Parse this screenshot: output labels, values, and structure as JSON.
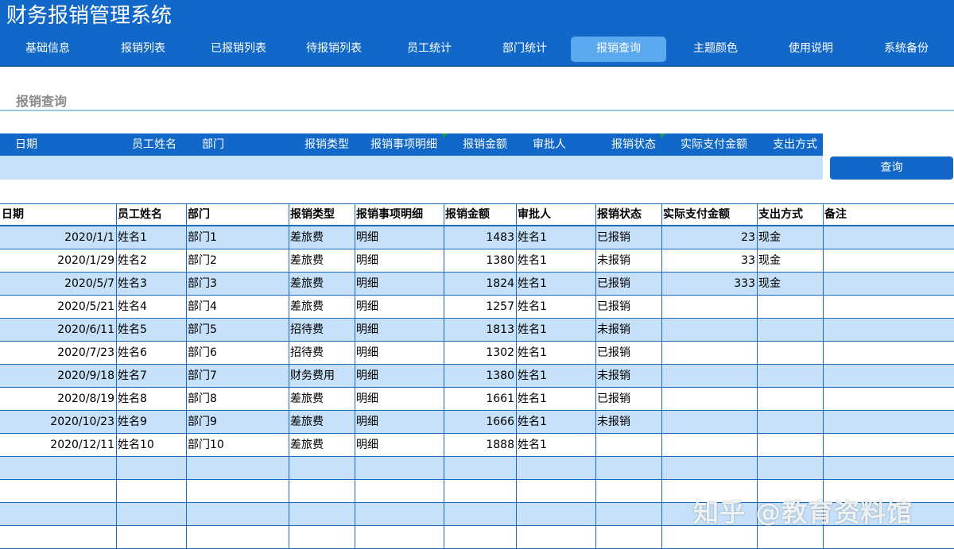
{
  "app_title": "财务报销管理系统",
  "nav": [
    {
      "label": "基础信息",
      "name": "nav-basic-info"
    },
    {
      "label": "报销列表",
      "name": "nav-reimburse-list"
    },
    {
      "label": "已报销列表",
      "name": "nav-reimbursed-list"
    },
    {
      "label": "待报销列表",
      "name": "nav-pending-list"
    },
    {
      "label": "员工统计",
      "name": "nav-employee-stats"
    },
    {
      "label": "部门统计",
      "name": "nav-department-stats"
    },
    {
      "label": "报销查询",
      "name": "nav-reimburse-query",
      "active": true
    },
    {
      "label": "主题颜色",
      "name": "nav-theme-color"
    },
    {
      "label": "使用说明",
      "name": "nav-instructions"
    },
    {
      "label": "系统备份",
      "name": "nav-system-backup"
    }
  ],
  "section_title": "报销查询",
  "filter": {
    "headers": [
      "日期",
      "员工姓名",
      "部门",
      "报销类型",
      "报销事项明细",
      "报销金额",
      "审批人",
      "报销状态",
      "实际支付金额",
      "支出方式"
    ],
    "query_button": "查询"
  },
  "table": {
    "columns": [
      "日期",
      "员工姓名",
      "部门",
      "报销类型",
      "报销事项明细",
      "报销金额",
      "审批人",
      "报销状态",
      "实际支付金额",
      "支出方式",
      "备注"
    ],
    "rows": [
      [
        "2020/1/1",
        "姓名1",
        "部门1",
        "差旅费",
        "明细",
        "1483",
        "姓名1",
        "已报销",
        "23",
        "现金",
        ""
      ],
      [
        "2020/1/29",
        "姓名2",
        "部门2",
        "差旅费",
        "明细",
        "1380",
        "姓名1",
        "未报销",
        "33",
        "现金",
        ""
      ],
      [
        "2020/5/7",
        "姓名3",
        "部门3",
        "差旅费",
        "明细",
        "1824",
        "姓名1",
        "已报销",
        "333",
        "现金",
        ""
      ],
      [
        "2020/5/21",
        "姓名4",
        "部门4",
        "差旅费",
        "明细",
        "1257",
        "姓名1",
        "已报销",
        "",
        "",
        ""
      ],
      [
        "2020/6/11",
        "姓名5",
        "部门5",
        "招待费",
        "明细",
        "1813",
        "姓名1",
        "未报销",
        "",
        "",
        ""
      ],
      [
        "2020/7/23",
        "姓名6",
        "部门6",
        "招待费",
        "明细",
        "1302",
        "姓名1",
        "已报销",
        "",
        "",
        ""
      ],
      [
        "2020/9/18",
        "姓名7",
        "部门7",
        "财务费用",
        "明细",
        "1380",
        "姓名1",
        "未报销",
        "",
        "",
        ""
      ],
      [
        "2020/8/19",
        "姓名8",
        "部门8",
        "差旅费",
        "明细",
        "1661",
        "姓名1",
        "已报销",
        "",
        "",
        ""
      ],
      [
        "2020/10/23",
        "姓名9",
        "部门9",
        "差旅费",
        "明细",
        "1666",
        "姓名1",
        "未报销",
        "",
        "",
        ""
      ],
      [
        "2020/12/11",
        "姓名10",
        "部门10",
        "差旅费",
        "明细",
        "1888",
        "姓名1",
        "",
        "",
        "",
        ""
      ],
      [
        "",
        "",
        "",
        "",
        "",
        "",
        "",
        "",
        "",
        "",
        ""
      ],
      [
        "",
        "",
        "",
        "",
        "",
        "",
        "",
        "",
        "",
        "",
        ""
      ],
      [
        "",
        "",
        "",
        "",
        "",
        "",
        "",
        "",
        "",
        "",
        ""
      ],
      [
        "",
        "",
        "",
        "",
        "",
        "",
        "",
        "",
        "",
        "",
        ""
      ]
    ]
  },
  "watermark": "知乎 @教育资料馆",
  "colors": {
    "primary": "#1168c8",
    "active_tab": "#5aa8ee",
    "row_stripe": "#c5e0f8",
    "grid_line": "#1b6bb8"
  }
}
